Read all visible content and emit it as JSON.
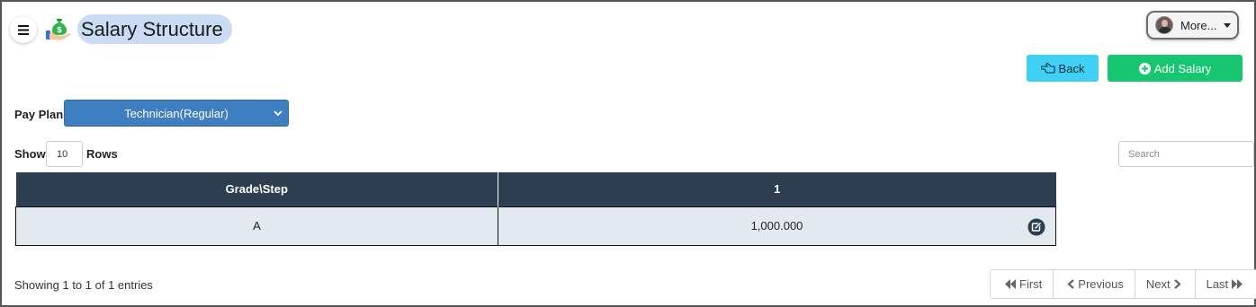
{
  "header": {
    "title": "Salary Structure",
    "more_label": "More...",
    "icons": {
      "menu": "hamburger-icon",
      "logo": "money-bag-hand-icon",
      "avatar": "user-avatar",
      "caret": "caret-down-icon"
    }
  },
  "actions": {
    "back_label": "Back",
    "add_label": "Add Salary",
    "colors": {
      "back": "#3ed0f5",
      "add": "#17c671"
    }
  },
  "filter": {
    "pay_plan_label": "Pay Plan:",
    "pay_plan_value": "Technician(Regular)",
    "select_color": "#3f7fc1"
  },
  "length_control": {
    "show_label": "Show",
    "rows_value": "10",
    "rows_label": "Rows"
  },
  "search": {
    "placeholder": "Search"
  },
  "table": {
    "header_color": "#2d3e50",
    "columns": [
      "Grade\\Step",
      "1"
    ],
    "rows": [
      {
        "grade": "A",
        "values": [
          "1,000.000"
        ]
      }
    ]
  },
  "footer": {
    "info": "Showing 1 to 1 of 1 entries",
    "pagination": {
      "first": "First",
      "previous": "Previous",
      "next": "Next",
      "last": "Last"
    }
  }
}
